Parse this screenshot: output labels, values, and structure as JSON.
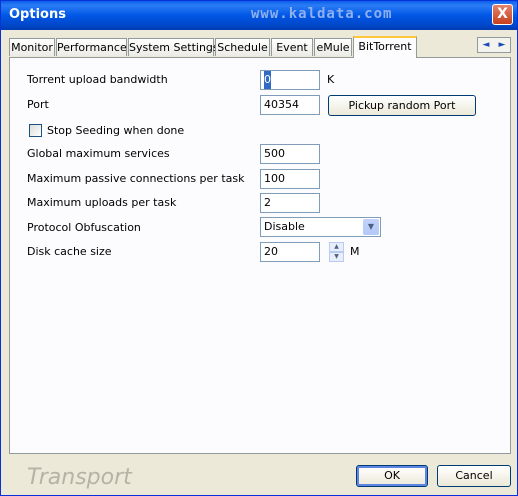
{
  "window": {
    "title": "Options",
    "watermark": "www.kaldata.com",
    "close_label": "X"
  },
  "tabs": [
    {
      "label": "Monitor",
      "active": false
    },
    {
      "label": "Performance",
      "active": false
    },
    {
      "label": "System Settings",
      "active": false
    },
    {
      "label": "Schedule",
      "active": false
    },
    {
      "label": "Event",
      "active": false
    },
    {
      "label": "eMule",
      "active": false
    },
    {
      "label": "BitTorrent",
      "active": true
    }
  ],
  "tab_scroll": {
    "left": "◄",
    "right": "►"
  },
  "bittorrent": {
    "upload_bandwidth": {
      "label": "Torrent upload bandwidth",
      "value": "0",
      "unit": "K"
    },
    "port": {
      "label": "Port",
      "value": "40354",
      "button": "Pickup random Port"
    },
    "stop_seeding": {
      "label": "Stop Seeding when done",
      "checked": false
    },
    "global_max_services": {
      "label": "Global maximum services",
      "value": "500"
    },
    "max_passive": {
      "label": "Maximum passive connections per task",
      "value": "100"
    },
    "max_uploads": {
      "label": "Maximum uploads per task",
      "value": "2"
    },
    "obfuscation": {
      "label": "Protocol Obfuscation",
      "value": "Disable",
      "arrow": "▼"
    },
    "disk_cache": {
      "label": "Disk cache size",
      "value": "20",
      "unit": "M",
      "up": "▲",
      "down": "▼"
    }
  },
  "footer": {
    "brand": "Transport",
    "ok": "OK",
    "cancel": "Cancel"
  },
  "colors": {
    "titlebar": "#0054e3",
    "tab_highlight": "#ffc83c",
    "button_border": "#003c74",
    "ok_focus": "#5d84e0"
  }
}
